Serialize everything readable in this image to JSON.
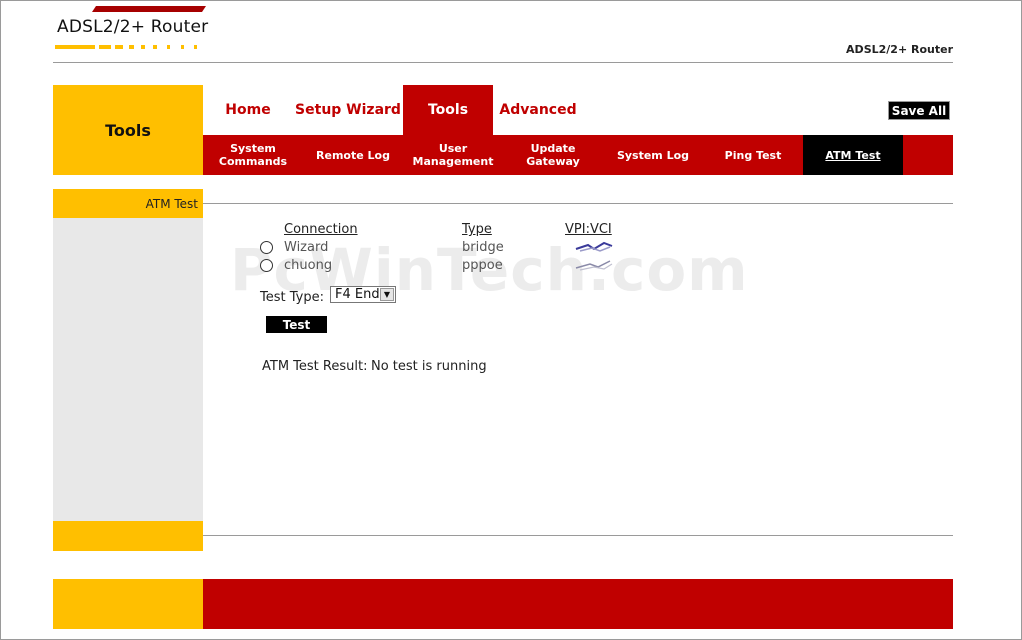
{
  "header": {
    "logo_text": "ADSL2/2+ Router",
    "brand_right": "ADSL2/2+ Router"
  },
  "section_title": "Tools",
  "main_tabs": [
    {
      "label": "Home",
      "active": false
    },
    {
      "label": "Setup Wizard",
      "active": false
    },
    {
      "label": "Tools",
      "active": true
    },
    {
      "label": "Advanced",
      "active": false
    }
  ],
  "save_all_label": "Save All",
  "sub_tabs": [
    {
      "label": "System Commands",
      "active": false
    },
    {
      "label": "Remote Log",
      "active": false
    },
    {
      "label": "User Management",
      "active": false
    },
    {
      "label": "Update Gateway",
      "active": false
    },
    {
      "label": "System Log",
      "active": false
    },
    {
      "label": "Ping Test",
      "active": false
    },
    {
      "label": "ATM Test",
      "active": true
    }
  ],
  "sidebar": {
    "current": "ATM Test"
  },
  "watermark": "PcWinTech.com",
  "connections": {
    "headers": {
      "connection": "Connection",
      "type": "Type",
      "vpi_vci": "VPI:VCI"
    },
    "rows": [
      {
        "name": "Wizard",
        "type": "bridge",
        "vpi_vci_icon": "vc-link-icon"
      },
      {
        "name": "chuong",
        "type": "pppoe",
        "vpi_vci_icon": "vc-link-icon"
      }
    ]
  },
  "test_type": {
    "label": "Test Type:",
    "selected": "F4 End"
  },
  "test_button_label": "Test",
  "result": {
    "label": "ATM Test Result:",
    "value": "No test is running"
  },
  "colors": {
    "accent_red": "#c00000",
    "accent_yellow": "#ffbf00",
    "sidebar_gray": "#e8e8e8"
  }
}
